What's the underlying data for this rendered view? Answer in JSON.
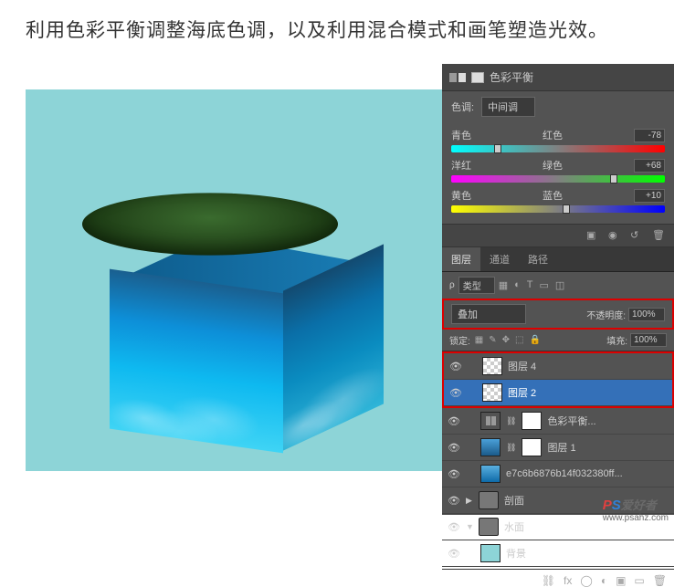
{
  "instruction": "利用色彩平衡调整海底色调，以及利用混合模式和画笔塑造光效。",
  "color_balance": {
    "title": "色彩平衡",
    "tone_label": "色调:",
    "tone_value": "中间调",
    "sliders": [
      {
        "left": "青色",
        "right": "红色",
        "value": "-78",
        "pos": 22
      },
      {
        "left": "洋红",
        "right": "绿色",
        "value": "+68",
        "pos": 76
      },
      {
        "left": "黄色",
        "right": "蓝色",
        "value": "+10",
        "pos": 54
      }
    ]
  },
  "tabs": {
    "layers": "图层",
    "channels": "通道",
    "paths": "路径"
  },
  "layer_type": {
    "label": "类型"
  },
  "blend": {
    "mode": "叠加",
    "opacity_label": "不透明度:",
    "opacity_value": "100%"
  },
  "lock": {
    "label": "锁定:",
    "fill_label": "填充:",
    "fill_value": "100%"
  },
  "layers": [
    {
      "id": "layer-4",
      "name": "图层 4",
      "thumb": "checker",
      "selected": false,
      "hl": true
    },
    {
      "id": "layer-2",
      "name": "图层 2",
      "thumb": "checker",
      "selected": true,
      "hl": true
    },
    {
      "id": "cb-adj",
      "name": "色彩平衡...",
      "thumb": "cb",
      "mask": true,
      "selected": false
    },
    {
      "id": "layer-1",
      "name": "图层 1",
      "thumb": "blue",
      "mask": true,
      "selected": false
    },
    {
      "id": "smart",
      "name": "e7c6b6876b14f032380ff...",
      "thumb": "sky",
      "selected": false
    },
    {
      "id": "grp-1",
      "name": "剖面",
      "folder": true,
      "open": false
    },
    {
      "id": "grp-2",
      "name": "水面",
      "folder": true,
      "open": true
    },
    {
      "id": "bg",
      "name": "背景",
      "thumb": "teal",
      "selected": false
    }
  ],
  "watermark": {
    "ps": "PS",
    "text": "爱好者",
    "url": "www.psahz.com"
  }
}
